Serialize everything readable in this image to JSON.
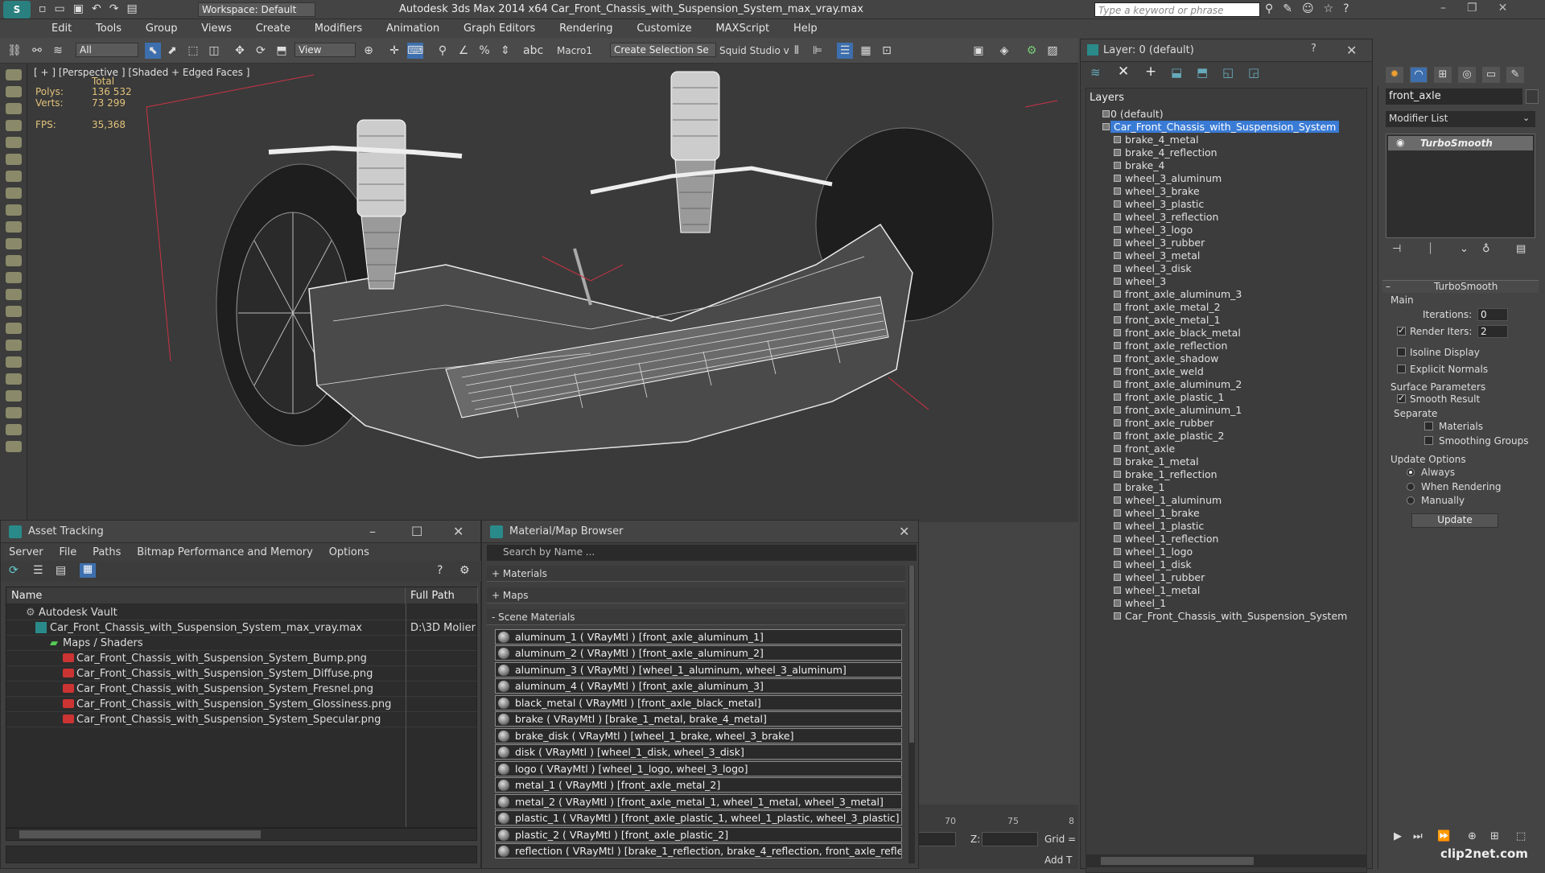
{
  "app": {
    "title": "Autodesk 3ds Max  2014 x64    Car_Front_Chassis_with_Suspension_System_max_vray.max",
    "workspace": "Workspace: Default",
    "search_placeholder": "Type a keyword or phrase"
  },
  "menu": [
    "Edit",
    "Tools",
    "Group",
    "Views",
    "Create",
    "Modifiers",
    "Animation",
    "Graph Editors",
    "Rendering",
    "Customize",
    "MAXScript",
    "Help"
  ],
  "toolbar": {
    "filter": "All",
    "refcoord": "View",
    "macro": "Macro1",
    "selection_set": "Create Selection Se",
    "squid": "Squid Studio v"
  },
  "viewport": {
    "label": "[ + ] [Perspective ] [Shaded + Edged Faces ]",
    "stats_header": "Total",
    "polys_label": "Polys:",
    "polys_value": "136 532",
    "verts_label": "Verts:",
    "verts_value": "73 299",
    "fps_label": "FPS:",
    "fps_value": "35,368"
  },
  "timeline": {
    "ticks": [
      "70",
      "75",
      "8"
    ],
    "z_label": "Z:",
    "grid_label": "Grid =",
    "add_t": "Add T"
  },
  "asset_tracking": {
    "title": "Asset Tracking",
    "menu": [
      "Server",
      "File",
      "Paths",
      "Bitmap Performance and Memory",
      "Options"
    ],
    "col_name": "Name",
    "col_path": "Full Path",
    "rows": [
      {
        "name": "Autodesk Vault",
        "path": ""
      },
      {
        "name": "Car_Front_Chassis_with_Suspension_System_max_vray.max",
        "path": "D:\\3D Molier I"
      },
      {
        "name": "Maps / Shaders",
        "path": ""
      },
      {
        "name": "Car_Front_Chassis_with_Suspension_System_Bump.png",
        "path": ""
      },
      {
        "name": "Car_Front_Chassis_with_Suspension_System_Diffuse.png",
        "path": ""
      },
      {
        "name": "Car_Front_Chassis_with_Suspension_System_Fresnel.png",
        "path": ""
      },
      {
        "name": "Car_Front_Chassis_with_Suspension_System_Glossiness.png",
        "path": ""
      },
      {
        "name": "Car_Front_Chassis_with_Suspension_System_Specular.png",
        "path": ""
      }
    ]
  },
  "material_browser": {
    "title": "Material/Map Browser",
    "search_placeholder": "Search by Name ...",
    "groups": [
      "+ Materials",
      "+ Maps",
      "- Scene Materials"
    ],
    "materials": [
      "aluminum_1  ( VRayMtl ) [front_axle_aluminum_1]",
      "aluminum_2  ( VRayMtl ) [front_axle_aluminum_2]",
      "aluminum_3  ( VRayMtl ) [wheel_1_aluminum, wheel_3_aluminum]",
      "aluminum_4  ( VRayMtl ) [front_axle_aluminum_3]",
      "black_metal  ( VRayMtl ) [front_axle_black_metal]",
      "brake  ( VRayMtl ) [brake_1_metal, brake_4_metal]",
      "brake_disk  ( VRayMtl ) [wheel_1_brake, wheel_3_brake]",
      "disk  ( VRayMtl ) [wheel_1_disk, wheel_3_disk]",
      "logo  ( VRayMtl ) [wheel_1_logo, wheel_3_logo]",
      "metal_1  ( VRayMtl ) [front_axle_metal_2]",
      "metal_2  ( VRayMtl ) [front_axle_metal_1, wheel_1_metal, wheel_3_metal]",
      "plastic_1  ( VRayMtl ) [front_axle_plastic_1, wheel_1_plastic, wheel_3_plastic]",
      "plastic_2  ( VRayMtl ) [front_axle_plastic_2]",
      "reflection  ( VRayMtl ) [brake_1_reflection, brake_4_reflection, front_axle_reflect..."
    ]
  },
  "layers": {
    "title": "Layer: 0 (default)",
    "header": "Layers",
    "items": [
      {
        "label": "0 (default)",
        "indent": 0
      },
      {
        "label": "Car_Front_Chassis_with_Suspension_System",
        "indent": 0,
        "selected": true
      },
      {
        "label": "brake_4_metal",
        "indent": 1
      },
      {
        "label": "brake_4_reflection",
        "indent": 1
      },
      {
        "label": "brake_4",
        "indent": 1
      },
      {
        "label": "wheel_3_aluminum",
        "indent": 1
      },
      {
        "label": "wheel_3_brake",
        "indent": 1
      },
      {
        "label": "wheel_3_plastic",
        "indent": 1
      },
      {
        "label": "wheel_3_reflection",
        "indent": 1
      },
      {
        "label": "wheel_3_logo",
        "indent": 1
      },
      {
        "label": "wheel_3_rubber",
        "indent": 1
      },
      {
        "label": "wheel_3_metal",
        "indent": 1
      },
      {
        "label": "wheel_3_disk",
        "indent": 1
      },
      {
        "label": "wheel_3",
        "indent": 1
      },
      {
        "label": "front_axle_aluminum_3",
        "indent": 1
      },
      {
        "label": "front_axle_metal_2",
        "indent": 1
      },
      {
        "label": "front_axle_metal_1",
        "indent": 1
      },
      {
        "label": "front_axle_black_metal",
        "indent": 1
      },
      {
        "label": "front_axle_reflection",
        "indent": 1
      },
      {
        "label": "front_axle_shadow",
        "indent": 1
      },
      {
        "label": "front_axle_weld",
        "indent": 1
      },
      {
        "label": "front_axle_aluminum_2",
        "indent": 1
      },
      {
        "label": "front_axle_plastic_1",
        "indent": 1
      },
      {
        "label": "front_axle_aluminum_1",
        "indent": 1
      },
      {
        "label": "front_axle_rubber",
        "indent": 1
      },
      {
        "label": "front_axle_plastic_2",
        "indent": 1
      },
      {
        "label": "front_axle",
        "indent": 1
      },
      {
        "label": "brake_1_metal",
        "indent": 1
      },
      {
        "label": "brake_1_reflection",
        "indent": 1
      },
      {
        "label": "brake_1",
        "indent": 1
      },
      {
        "label": "wheel_1_aluminum",
        "indent": 1
      },
      {
        "label": "wheel_1_brake",
        "indent": 1
      },
      {
        "label": "wheel_1_plastic",
        "indent": 1
      },
      {
        "label": "wheel_1_reflection",
        "indent": 1
      },
      {
        "label": "wheel_1_logo",
        "indent": 1
      },
      {
        "label": "wheel_1_disk",
        "indent": 1
      },
      {
        "label": "wheel_1_rubber",
        "indent": 1
      },
      {
        "label": "wheel_1_metal",
        "indent": 1
      },
      {
        "label": "wheel_1",
        "indent": 1
      },
      {
        "label": "Car_Front_Chassis_with_Suspension_System",
        "indent": 1
      }
    ]
  },
  "command_panel": {
    "object_name": "front_axle",
    "modifier_list": "Modifier List",
    "stack_item": "TurboSmooth",
    "rollout_title": "TurboSmooth",
    "main_label": "Main",
    "iterations_label": "Iterations:",
    "iterations_value": "0",
    "render_iters_label": "Render Iters:",
    "render_iters_value": "2",
    "render_iters_checked": true,
    "isoline_label": "Isoline Display",
    "explicit_label": "Explicit Normals",
    "surface_label": "Surface Parameters",
    "smooth_result_label": "Smooth Result",
    "smooth_result_checked": true,
    "separate_label": "Separate",
    "materials_label": "Materials",
    "smoothing_groups_label": "Smoothing Groups",
    "update_options_label": "Update Options",
    "always_label": "Always",
    "when_rendering_label": "When Rendering",
    "manually_label": "Manually",
    "update_button": "Update"
  },
  "watermark": "clip2net.com"
}
